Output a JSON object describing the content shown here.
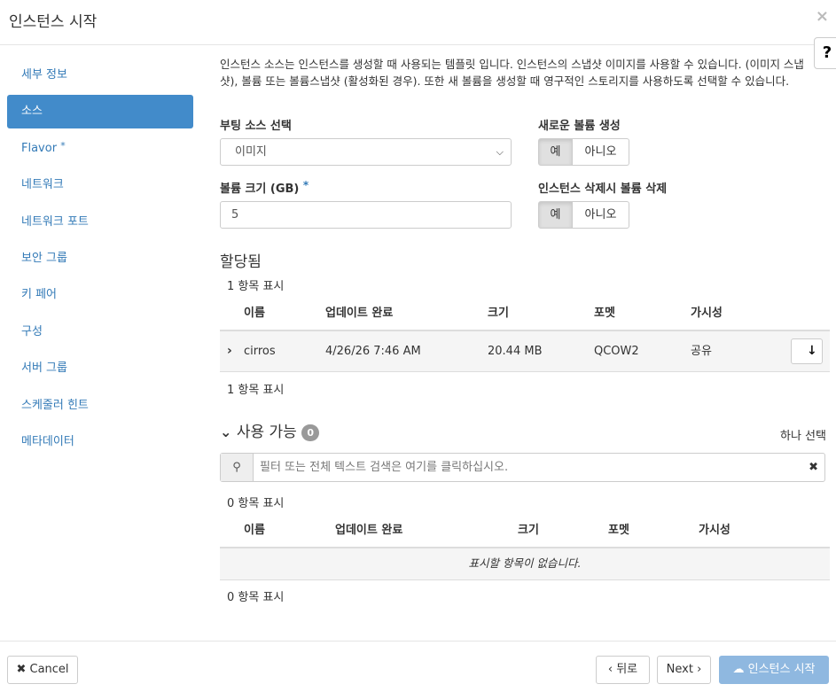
{
  "modal": {
    "title": "인스턴스 시작",
    "close_icon": "×",
    "help_icon": "?"
  },
  "nav": {
    "items": [
      {
        "label": "세부 정보",
        "active": false,
        "required": false
      },
      {
        "label": "소스",
        "active": true,
        "required": false
      },
      {
        "label": "Flavor",
        "active": false,
        "required": true
      },
      {
        "label": "네트워크",
        "active": false,
        "required": false
      },
      {
        "label": "네트워크 포트",
        "active": false,
        "required": false
      },
      {
        "label": "보안 그룹",
        "active": false,
        "required": false
      },
      {
        "label": "키 페어",
        "active": false,
        "required": false
      },
      {
        "label": "구성",
        "active": false,
        "required": false
      },
      {
        "label": "서버 그룹",
        "active": false,
        "required": false
      },
      {
        "label": "스케줄러 힌트",
        "active": false,
        "required": false
      },
      {
        "label": "메타데이터",
        "active": false,
        "required": false
      }
    ],
    "required_mark": "*"
  },
  "source": {
    "description": "인스턴스 소스는 인스턴스를 생성할 때 사용되는 템플릿 입니다. 인스턴스의 스냅샷 이미지를 사용할 수 있습니다. (이미지 스냅샷), 볼륨 또는 볼륨스냅샷 (활성화된 경우). 또한 새 볼륨을 생성할 때 영구적인 스토리지를 사용하도록 선택할 수 있습니다.",
    "boot_source_label": "부팅 소스 선택",
    "boot_source_value": "이미지",
    "volume_size_label": "볼륨 크기 (GB)",
    "volume_size_required": "*",
    "volume_size_value": "5",
    "create_volume_label": "새로운 볼륨 생성",
    "delete_volume_label": "인스턴스 삭제시 볼륨 삭제",
    "yes": "예",
    "no": "아니오"
  },
  "allocated": {
    "title": "할당됨",
    "count_text": "1 항목 표시",
    "columns": [
      "이름",
      "업데이트 완료",
      "크기",
      "포멧",
      "가시성"
    ],
    "rows": [
      {
        "name": "cirros",
        "updated": "4/26/26 7:46 AM",
        "size": "20.44 MB",
        "format": "QCOW2",
        "visibility": "공유"
      }
    ]
  },
  "available": {
    "title": "사용 가능",
    "badge": "0",
    "select_one": "하나 선택",
    "filter_placeholder": "필터 또는 전체 텍스트 검색은 여기를 클릭하십시오.",
    "count_text": "0 항목 표시",
    "columns": [
      "이름",
      "업데이트 완료",
      "크기",
      "포멧",
      "가시성"
    ],
    "empty_text": "표시할 항목이 없습니다."
  },
  "footer": {
    "cancel": "Cancel",
    "back": "뒤로",
    "next": "Next",
    "launch": "인스턴스 시작"
  }
}
